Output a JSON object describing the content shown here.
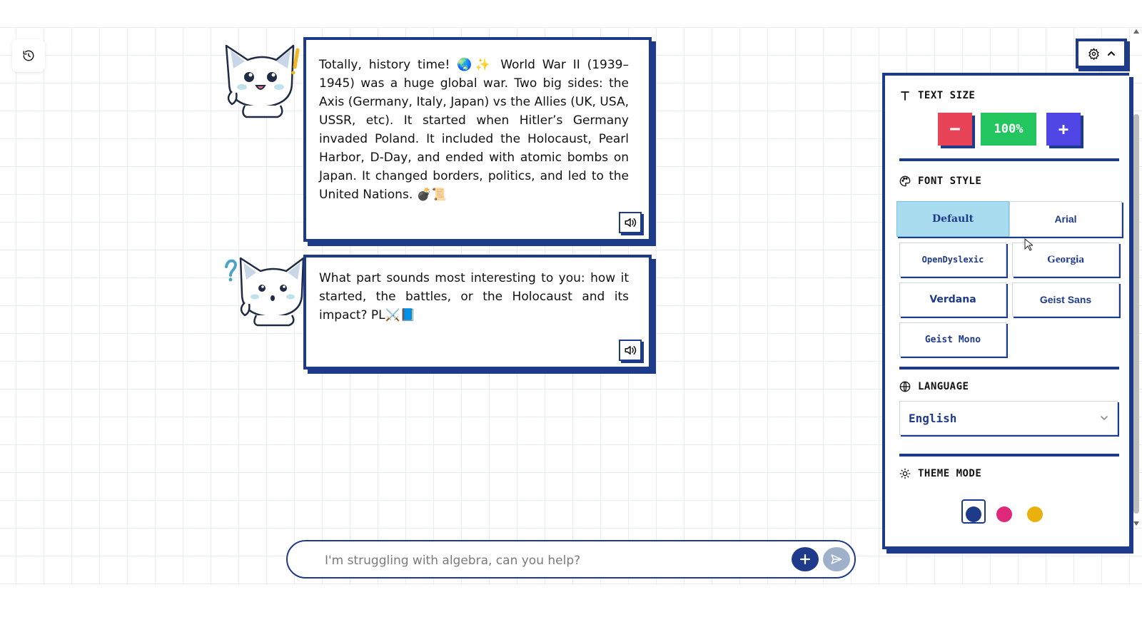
{
  "chat": {
    "messages": [
      {
        "role": "assistant",
        "text": "Totally, history time! 🌏✨ World War II (1939–1945) was a huge global war. Two big sides: the Axis (Germany, Italy, Japan) vs the Allies (UK, USA, USSR, etc). It started when Hitler’s Germany invaded Poland. It included the Holocaust, Pearl Harbor, D-Day, and ended with atomic bombs on Japan. It changed borders, politics, and led to the United Nations. 💣📜"
      },
      {
        "role": "assistant",
        "text": "What part sounds most interesting to you: how it started, the battles, or the Holocaust and its impact? PL⚔️📘"
      }
    ]
  },
  "input": {
    "placeholder": "I'm struggling with algebra, can you help?",
    "value": ""
  },
  "settings": {
    "text_size": {
      "label": "TEXT SIZE",
      "value": "100%",
      "decrease": "−",
      "increase": "+"
    },
    "font_style": {
      "label": "FONT STYLE",
      "options": [
        "Default",
        "Arial",
        "OpenDyslexic",
        "Georgia",
        "Verdana",
        "Geist Sans",
        "Geist Mono"
      ],
      "selected": "Default"
    },
    "language": {
      "label": "LANGUAGE",
      "value": "English"
    },
    "theme_mode": {
      "label": "THEME MODE",
      "colors": [
        "#1e3a8a",
        "#e0287a",
        "#e8b10d"
      ],
      "selected": 0
    }
  },
  "colors": {
    "primary": "#1e3a8a",
    "danger": "#e94357",
    "success": "#22c55e",
    "accent": "#4f46e5",
    "selected_font_bg": "#a8dcee"
  },
  "icons": {
    "history": "history-icon",
    "speaker": "speaker-icon",
    "plus": "plus-icon",
    "send": "send-icon",
    "gear": "gear-icon",
    "chevron_up": "chevron-up-icon"
  }
}
